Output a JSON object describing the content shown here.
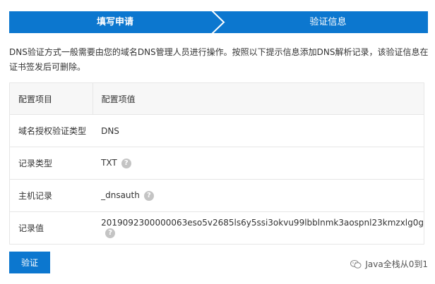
{
  "steps": [
    "填写申请",
    "验证信息"
  ],
  "description": "DNS验证方式一般需要由您的域名DNS管理人员进行操作。按照以下提示信息添加DNS解析记录，该验证信息在证书签发后可删除。",
  "table": {
    "headers": [
      "配置项目",
      "配置项值"
    ],
    "rows": [
      {
        "label": "域名授权验证类型",
        "value": "DNS",
        "help": false
      },
      {
        "label": "记录类型",
        "value": "TXT",
        "help": true
      },
      {
        "label": "主机记录",
        "value": "_dnsauth",
        "help": true
      },
      {
        "label": "记录值",
        "value": "2019092300000063eso5v2685ls6y5ssi3okvu99lbblnmk3aospnl23kmzxlg0g",
        "help": true
      }
    ]
  },
  "verify_button": "验证",
  "watermark": "Java全栈从0到1",
  "colors": {
    "primary": "#0c77cf",
    "help_icon": "#c4c4c4"
  }
}
